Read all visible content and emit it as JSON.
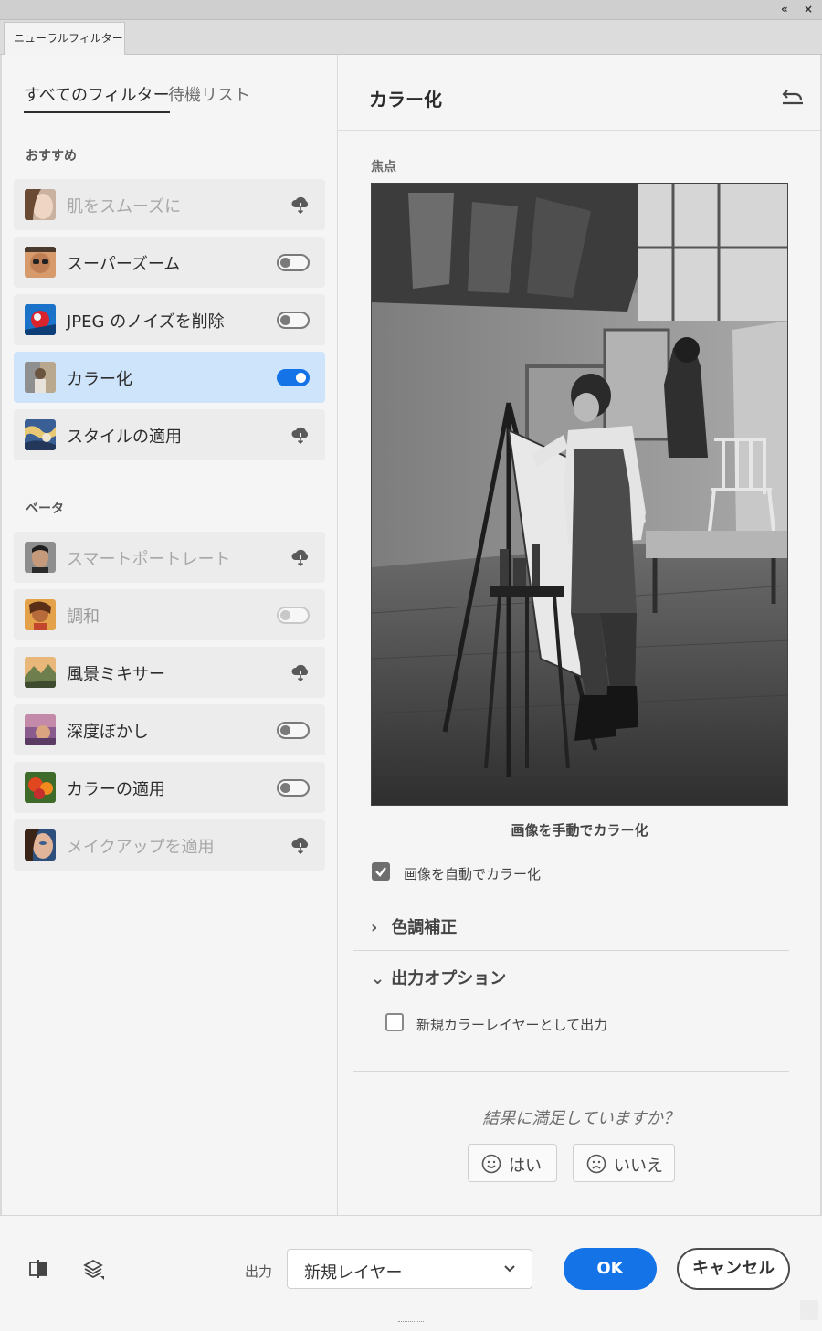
{
  "window": {
    "title": "ニューラルフィルター"
  },
  "left_panel": {
    "tabs": [
      {
        "label": "すべてのフィルター",
        "active": true
      },
      {
        "label": "待機リスト",
        "active": false
      }
    ],
    "sections": [
      {
        "label": "おすすめ",
        "items": [
          {
            "label": "肌をスムーズに",
            "control": "cloud",
            "dim": true
          },
          {
            "label": "スーパーズーム",
            "control": "toggle-off",
            "dim": false
          },
          {
            "label": "JPEG のノイズを削除",
            "control": "toggle-off",
            "dim": false
          },
          {
            "label": "カラー化",
            "control": "toggle-on",
            "dim": false,
            "selected": true
          },
          {
            "label": "スタイルの適用",
            "control": "cloud",
            "dim": false
          }
        ]
      },
      {
        "label": "ベータ",
        "items": [
          {
            "label": "スマートポートレート",
            "control": "cloud",
            "dim": true
          },
          {
            "label": "調和",
            "control": "toggle-disabled",
            "dim": true
          },
          {
            "label": "風景ミキサー",
            "control": "cloud",
            "dim": false
          },
          {
            "label": "深度ぼかし",
            "control": "toggle-off",
            "dim": false
          },
          {
            "label": "カラーの適用",
            "control": "toggle-off",
            "dim": false
          },
          {
            "label": "メイクアップを適用",
            "control": "cloud",
            "dim": true
          }
        ]
      }
    ]
  },
  "right_panel": {
    "title": "カラー化",
    "focus_label": "焦点",
    "photo_caption": "画像を手動でカラー化",
    "auto_colorize": {
      "label": "画像を自動でカラー化",
      "checked": true
    },
    "accordions": [
      {
        "label": "色調補正",
        "expanded": false
      },
      {
        "label": "出力オプション",
        "expanded": true
      }
    ],
    "new_color_layer": {
      "label": "新規カラーレイヤーとして出力",
      "checked": false
    },
    "feedback": {
      "question": "結果に満足していますか？",
      "yes": "はい",
      "no": "いいえ"
    }
  },
  "bottom_bar": {
    "output_label": "出力",
    "output_value": "新規レイヤー",
    "ok": "OK",
    "cancel": "キャンセル"
  },
  "colors": {
    "accent": "#1473e6",
    "selected_row": "#cde4fb"
  }
}
